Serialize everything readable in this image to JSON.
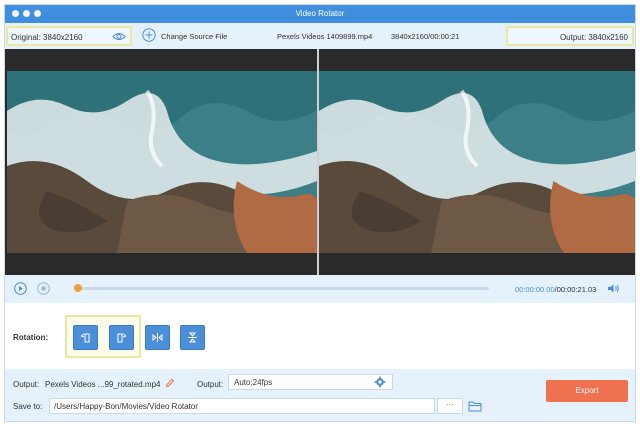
{
  "window": {
    "title": "Video Rotator"
  },
  "info_bar": {
    "original_label": "Original: 3840x2160",
    "change_source_label": "Change Source File",
    "file_name": "Pexels Videos 1409899.mp4",
    "file_meta": "3840x2160/00:00:21",
    "output_label": "Output: 3840x2160"
  },
  "playback": {
    "current_time": "00:00:00.00",
    "total_time": "/00:00:21.03",
    "progress_fraction": 0.0
  },
  "rotation": {
    "label": "Rotation:",
    "buttons": [
      "rotate-left",
      "rotate-right",
      "flip-horizontal",
      "flip-vertical"
    ]
  },
  "bottom": {
    "output_label": "Output:",
    "output_name": "Pexels Videos ...99_rotated.mp4",
    "format_label": "Output:",
    "format_value": "Auto;24fps",
    "save_label": "Save to:",
    "save_path": "/Users/Happy-Bon/Movies/Video Rotator",
    "browse_label": "···",
    "export_label": "Export"
  },
  "colors": {
    "accent": "#4a8fd8",
    "titlebar": "#3f8fde",
    "panel": "#e5f1fb",
    "highlight": "#e9e7a0",
    "export": "#f07150"
  }
}
